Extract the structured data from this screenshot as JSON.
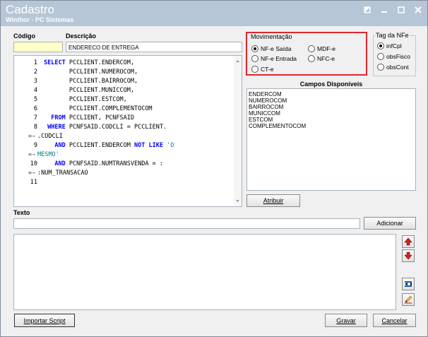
{
  "window": {
    "title": "Cadastro",
    "subtitle": "Winthor - PC Sistemas",
    "buttons": [
      "restore-icon",
      "minimize-icon",
      "maximize-icon",
      "close-icon"
    ]
  },
  "fields": {
    "codigo_label": "Código",
    "codigo_value": "",
    "descricao_label": "Descrição",
    "descricao_value": "ENDERECO DE ENTREGA",
    "texto_label": "Texto",
    "texto_value": ""
  },
  "sql_editor": {
    "lines": [
      {
        "num": "1",
        "text": "SELECT PCCLIENT.ENDERCOM,"
      },
      {
        "num": "2",
        "text": "       PCCLIENT.NUMEROCOM,"
      },
      {
        "num": "3",
        "text": "       PCCLIENT.BAIRROCOM,"
      },
      {
        "num": "4",
        "text": "       PCCLIENT.MUNICCOM,"
      },
      {
        "num": "5",
        "text": "       PCCLIENT.ESTCOM,"
      },
      {
        "num": "6",
        "text": "       PCCLIENT.COMPLEMENTOCOM"
      },
      {
        "num": "7",
        "text": "  FROM PCCLIENT, PCNFSAID"
      },
      {
        "num": "8",
        "text": " WHERE PCNFSAID.CODCLI = PCCLIENT."
      },
      {
        "num": "",
        "text": ".CODCLI",
        "wrap": true
      },
      {
        "num": "9",
        "text": "   AND PCCLIENT.ENDERCOM NOT LIKE 'O"
      },
      {
        "num": "",
        "text": "MESMO'",
        "wrap": true
      },
      {
        "num": "10",
        "text": "   AND PCNFSAID.NUMTRANSVENDA = :"
      },
      {
        "num": "",
        "text": ":NUM_TRANSACAO",
        "wrap": true
      },
      {
        "num": "11",
        "text": ""
      }
    ]
  },
  "movimentacao": {
    "title": "Movimentação",
    "options": [
      "NF-e Saída",
      "MDF-e",
      "NF-e Entrada",
      "NFC-e",
      "CT-e"
    ],
    "selected": "NF-e Saída"
  },
  "tag_nfe": {
    "title": "Tag da NFe",
    "options": [
      "infCpl",
      "obsFisco",
      "obsCont"
    ],
    "selected": "infCpl"
  },
  "campos": {
    "title": "Campos Disponíveis",
    "items": [
      "ENDERCOM",
      "NUMEROCOM",
      "BAIRROCOM",
      "MUNICCOM",
      "ESTCOM",
      "COMPLEMENTOCOM"
    ]
  },
  "buttons": {
    "atribuir": "Atribuir",
    "adicionar": "Adicionar",
    "importar": "Importar Script",
    "gravar": "Gravar",
    "cancelar": "Cancelar"
  },
  "side_icons": [
    "arrow-up-icon",
    "arrow-down-icon",
    "insert-field-icon",
    "edit-pencil-icon"
  ],
  "colors": {
    "title_bar": "#b6c6d6",
    "highlight_border": "#e0262e",
    "code_keyword": "#0000ff",
    "code_string": "#008080"
  }
}
